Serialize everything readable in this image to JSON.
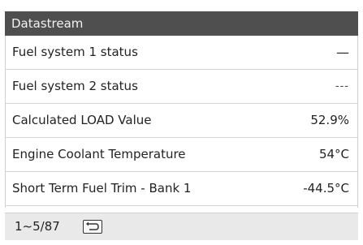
{
  "header": {
    "title": "Datastream"
  },
  "rows": [
    {
      "label": "Fuel system 1 status",
      "value": "—"
    },
    {
      "label": "Fuel system 2 status",
      "value": "---"
    },
    {
      "label": "Calculated LOAD Value",
      "value": "52.9%"
    },
    {
      "label": "Engine Coolant Temperature",
      "value": "54°C"
    },
    {
      "label": "Short Term Fuel Trim - Bank 1",
      "value": "-44.5°C"
    }
  ],
  "footer": {
    "pager": "1~5/87",
    "back_icon": "back-icon"
  }
}
